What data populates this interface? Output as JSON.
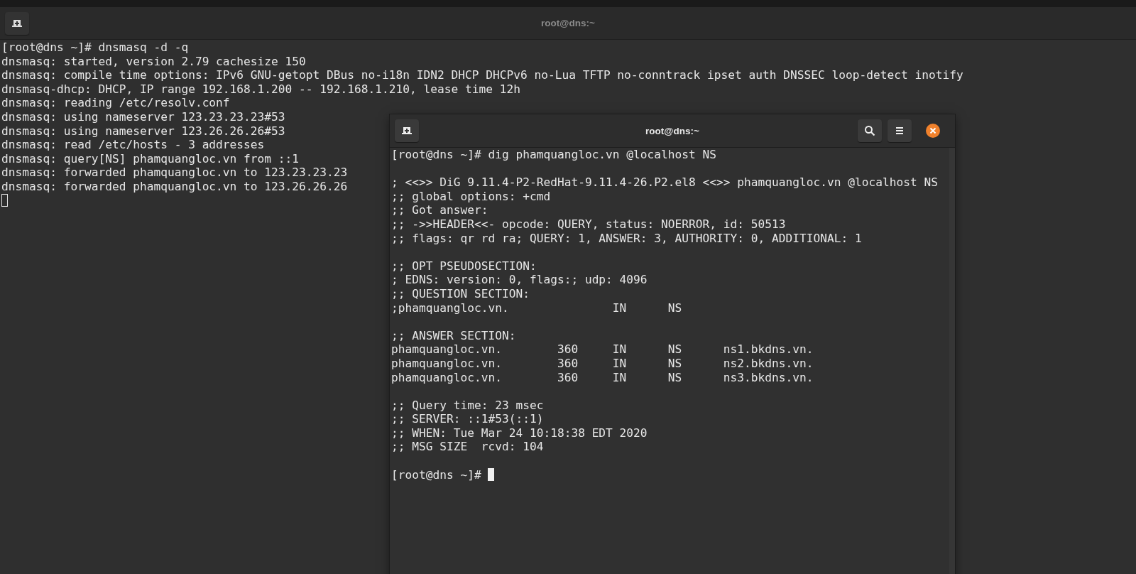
{
  "back_window": {
    "title": "root@dns:~",
    "focused": false,
    "blocks": [
      [
        "[root@dns ~]# dnsmasq -d -q",
        "dnsmasq: started, version 2.79 cachesize 150",
        "dnsmasq: compile time options: IPv6 GNU-getopt DBus no-i18n IDN2 DHCP DHCPv6 no-Lua TFTP no-conntrack ipset auth DNSSEC loop-detect inotify",
        "dnsmasq-dhcp: DHCP, IP range 192.168.1.200 -- 192.168.1.210, lease time 12h",
        "dnsmasq: reading /etc/resolv.conf",
        "dnsmasq: using nameserver 123.23.23.23#53",
        "dnsmasq: using nameserver 123.26.26.26#53",
        "dnsmasq: read /etc/hosts - 3 addresses",
        "dnsmasq: query[NS] phamquangloc.vn from ::1",
        "dnsmasq: forwarded phamquangloc.vn to 123.23.23.23",
        "dnsmasq: forwarded phamquangloc.vn to 123.26.26.26"
      ]
    ]
  },
  "front_window": {
    "title": "root@dns:~",
    "focused": true,
    "blocks": [
      [
        "[root@dns ~]# dig phamquangloc.vn @localhost NS"
      ],
      [
        "; <<>> DiG 9.11.4-P2-RedHat-9.11.4-26.P2.el8 <<>> phamquangloc.vn @localhost NS",
        ";; global options: +cmd",
        ";; Got answer:",
        ";; ->>HEADER<<- opcode: QUERY, status: NOERROR, id: 50513",
        ";; flags: qr rd ra; QUERY: 1, ANSWER: 3, AUTHORITY: 0, ADDITIONAL: 1"
      ],
      [
        ";; OPT PSEUDOSECTION:",
        "; EDNS: version: 0, flags:; udp: 4096",
        ";; QUESTION SECTION:",
        ";phamquangloc.vn.               IN      NS"
      ],
      [
        ";; ANSWER SECTION:",
        "phamquangloc.vn.        360     IN      NS      ns1.bkdns.vn.",
        "phamquangloc.vn.        360     IN      NS      ns2.bkdns.vn.",
        "phamquangloc.vn.        360     IN      NS      ns3.bkdns.vn."
      ],
      [
        ";; Query time: 23 msec",
        ";; SERVER: ::1#53(::1)",
        ";; WHEN: Tue Mar 24 10:18:38 EDT 2020",
        ";; MSG SIZE  rcvd: 104"
      ]
    ],
    "prompt": "[root@dns ~]# "
  }
}
